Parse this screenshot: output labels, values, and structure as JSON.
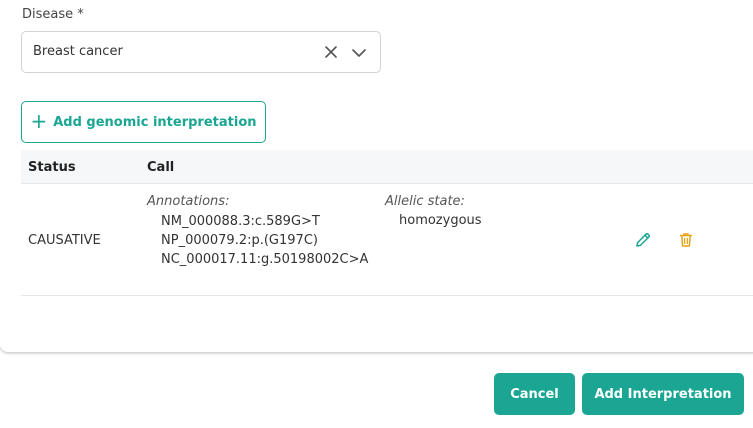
{
  "colors": {
    "accent": "#1aa693",
    "edit_icon": "#1aa693",
    "delete_icon": "#e8a317"
  },
  "disease_field": {
    "label": "Disease *",
    "value": "Breast cancer",
    "clear_icon": "close-icon",
    "dropdown_icon": "chevron-down-icon"
  },
  "add_genomic_button": {
    "icon": "plus-icon",
    "label": "Add genomic interpretation"
  },
  "table": {
    "headers": {
      "status": "Status",
      "call": "Call"
    },
    "rows": [
      {
        "status": "CAUSATIVE",
        "annotations_title": "Annotations:",
        "annotations": [
          "NM_000088.3:c.589G>T",
          "NP_000079.2:p.(G197C)",
          "NC_000017.11:g.50198002C>A"
        ],
        "allelic_state_title": "Allelic state:",
        "allelic_state": "homozygous",
        "actions": [
          "pencil-icon",
          "trash-icon"
        ]
      }
    ]
  },
  "footer": {
    "cancel_label": "Cancel",
    "add_interpretation_label": "Add Interpretation"
  }
}
